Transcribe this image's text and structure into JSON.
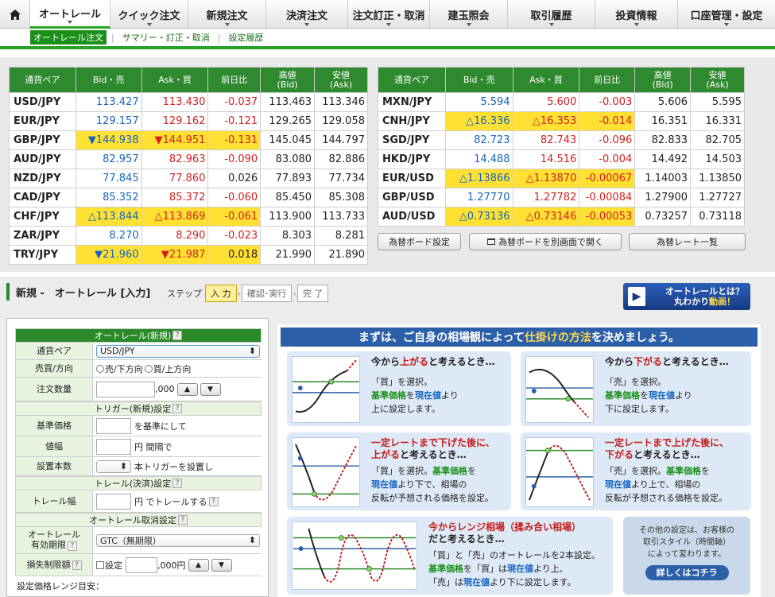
{
  "nav": {
    "home_icon": "home-icon",
    "tabs": [
      {
        "label": "オートレール"
      },
      {
        "label": "クイック注文"
      },
      {
        "label": "新規注文"
      },
      {
        "label": "決済注文"
      },
      {
        "label": "注文訂正・取消"
      },
      {
        "label": "建玉照会"
      },
      {
        "label": "取引履歴"
      },
      {
        "label": "投資情報"
      },
      {
        "label": "口座管理・設定"
      }
    ]
  },
  "subnav": {
    "items": [
      {
        "label": "オートレール注文"
      },
      {
        "label": "サマリー・訂正・取消"
      },
      {
        "label": "設定履歴"
      }
    ]
  },
  "rates": {
    "headers": [
      "通貨ペア",
      "Bid・売",
      "Ask・買",
      "前日比",
      "高値\n(Bid)",
      "安値\n(Ask)"
    ],
    "left": [
      {
        "pair": "USD/JPY",
        "bid": "113.427",
        "ask": "113.430",
        "chg": "-0.037",
        "high": "113.463",
        "low": "113.346"
      },
      {
        "pair": "EUR/JPY",
        "bid": "129.157",
        "ask": "129.162",
        "chg": "-0.121",
        "high": "129.265",
        "low": "129.058"
      },
      {
        "pair": "GBP/JPY",
        "bid": "▼144.938",
        "ask": "▼144.951",
        "chg": "-0.131",
        "high": "145.045",
        "low": "144.797"
      },
      {
        "pair": "AUD/JPY",
        "bid": "82.957",
        "ask": "82.963",
        "chg": "-0.090",
        "high": "83.080",
        "low": "82.886"
      },
      {
        "pair": "NZD/JPY",
        "bid": "77.845",
        "ask": "77.860",
        "chg": "0.026",
        "high": "77.893",
        "low": "77.734"
      },
      {
        "pair": "CAD/JPY",
        "bid": "85.352",
        "ask": "85.372",
        "chg": "-0.060",
        "high": "85.450",
        "low": "85.308"
      },
      {
        "pair": "CHF/JPY",
        "bid": "△113.844",
        "ask": "△113.869",
        "chg": "-0.061",
        "high": "113.900",
        "low": "113.733"
      },
      {
        "pair": "ZAR/JPY",
        "bid": "8.270",
        "ask": "8.290",
        "chg": "-0.023",
        "high": "8.303",
        "low": "8.281"
      },
      {
        "pair": "TRY/JPY",
        "bid": "▼21.960",
        "ask": "▼21.987",
        "chg": "0.018",
        "high": "21.990",
        "low": "21.890"
      }
    ],
    "right": [
      {
        "pair": "MXN/JPY",
        "bid": "5.594",
        "ask": "5.600",
        "chg": "-0.003",
        "high": "5.606",
        "low": "5.595"
      },
      {
        "pair": "CNH/JPY",
        "bid": "△16.336",
        "ask": "△16.353",
        "chg": "-0.014",
        "high": "16.351",
        "low": "16.331"
      },
      {
        "pair": "SGD/JPY",
        "bid": "82.723",
        "ask": "82.743",
        "chg": "-0.096",
        "high": "82.833",
        "low": "82.705"
      },
      {
        "pair": "HKD/JPY",
        "bid": "14.488",
        "ask": "14.516",
        "chg": "-0.004",
        "high": "14.492",
        "low": "14.503"
      },
      {
        "pair": "EUR/USD",
        "bid": "△1.13866",
        "ask": "△1.13870",
        "chg": "-0.00067",
        "high": "1.14003",
        "low": "1.13850"
      },
      {
        "pair": "GBP/USD",
        "bid": "1.27770",
        "ask": "1.27782",
        "chg": "-0.00084",
        "high": "1.27900",
        "low": "1.27727"
      },
      {
        "pair": "AUD/USD",
        "bid": "△0.73136",
        "ask": "△0.73146",
        "chg": "-0.00053",
        "high": "0.73257",
        "low": "0.73118"
      }
    ],
    "buttons": {
      "board_settings": "為替ボード設定",
      "open_board": "為替ボードを別画面で開く",
      "rate_list": "為替レート一覧"
    }
  },
  "page": {
    "title": "新規 -　オートレール [入力]",
    "steps_label": "ステップ",
    "steps": [
      "入 力",
      "確認･実行",
      "完 了"
    ],
    "whatis_line1": "オートレールとは？",
    "whatis_line2a": "丸わかり",
    "whatis_line2b": "動画！"
  },
  "form": {
    "header": "オートレール(新規)",
    "currency_label": "通貨ペア",
    "currency_value": "USD/JPY",
    "side_label": "売買/方向",
    "side_sell": "売/下方向",
    "side_buy": "買/上方向",
    "qty_label": "注文数量",
    "qty_suffix": ",000",
    "trigger_header": "トリガー(新規)設定",
    "base_price_label": "基準価格",
    "base_price_suffix": "を基準にして",
    "width_label": "値幅",
    "width_suffix": "円 間隔で",
    "count_label": "設置本数",
    "count_suffix": "本トリガーを設置し",
    "trail_header": "トレール(決済)設定",
    "trail_label": "トレール幅",
    "trail_suffix": "円 でトレールする",
    "cancel_header": "オートレール取消設定",
    "expiry_label_1": "オートレール",
    "expiry_label_2": "有効期限",
    "expiry_value": "GTC（無期限）",
    "loss_label": "損失制限額",
    "loss_checkbox": "設定",
    "loss_suffix": ",000円",
    "range_label": "設定価格レンジ目安："
  },
  "guide": {
    "title_a": "まずは、ご自身の相場観によって",
    "title_b": "仕掛けの方法",
    "title_c": "を決めましょう。",
    "card1_t1": "今から",
    "card1_t2": "上がる",
    "card1_t3": "と考えるとき…",
    "card1_d1": "「買」を選択。",
    "card1_d2a": "基準価格",
    "card1_d2b": "を",
    "card1_d2c": "現在値",
    "card1_d2d": "より",
    "card1_d3": "上に設定します。",
    "card2_t1": "今から",
    "card2_t2": "下がる",
    "card2_t3": "と考えるとき…",
    "card2_d1": "「売」を選択。",
    "card2_d2a": "基準価格",
    "card2_d2b": "を",
    "card2_d2c": "現在値",
    "card2_d2d": "より",
    "card2_d3": "下に設定します。",
    "card3_t1": "一定レートまで下げた後に、",
    "card3_t2": "上がる",
    "card3_t3": "と考えるとき…",
    "card3_d1a": "「買」を選択。",
    "card3_d1b": "基準価格",
    "card3_d1c": "を",
    "card3_d2a": "現在値",
    "card3_d2b": "より下で、相場の",
    "card3_d3": "反転が予想される価格を設定。",
    "card4_t1": "一定レートまで上げた後に、",
    "card4_t2": "下がる",
    "card4_t3": "と考えるとき…",
    "card4_d1a": "「売」を選択。",
    "card4_d1b": "基準価格",
    "card4_d1c": "を",
    "card4_d2a": "現在値",
    "card4_d2b": "より上で、相場の",
    "card4_d3": "反転が予想される価格を設定。",
    "card5_t1": "今からレンジ相場",
    "card5_t2": "（揉み合い相場）",
    "card5_t3": "だと考えるとき…",
    "card5_d1": "「買」と「売」のオートレールを2本設定。",
    "card5_d2a": "基準価格",
    "card5_d2b": "を「買」は",
    "card5_d2c": "現在値",
    "card5_d2d": "より上、",
    "card5_d3a": "「売」は",
    "card5_d3b": "現在値",
    "card5_d3c": "より下に設定します。",
    "other_1": "その他の設定は、お客様の",
    "other_2": "取引スタイル（時間軸）",
    "other_3": "によって変わります。",
    "other_btn": "詳しくはコチラ"
  }
}
